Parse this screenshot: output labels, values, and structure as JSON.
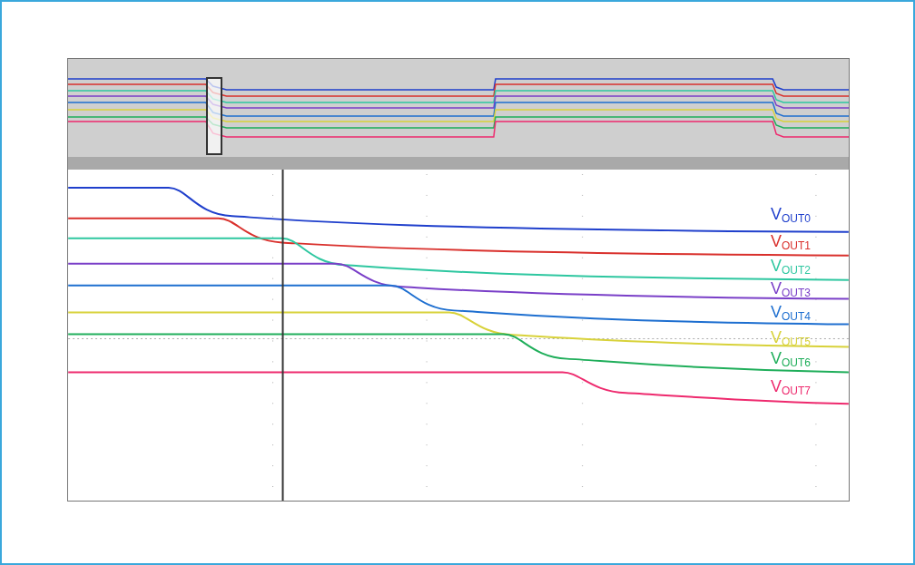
{
  "traces": [
    {
      "label": "V$_{OUT0}$",
      "color": "#1f3fcc"
    },
    {
      "label": "V$_{OUT1}$",
      "color": "#d9302c"
    },
    {
      "label": "V$_{OUT2}$",
      "color": "#2ec7a0"
    },
    {
      "label": "V$_{OUT3}$",
      "color": "#7a3fc8"
    },
    {
      "label": "V$_{OUT4}$",
      "color": "#1e6fd0"
    },
    {
      "label": "V$_{OUT5}$",
      "color": "#d8d23a"
    },
    {
      "label": "V$_{OUT6}$",
      "color": "#1fae5a"
    },
    {
      "label": "V$_{OUT7}$",
      "color": "#ee2a6e"
    }
  ]
}
